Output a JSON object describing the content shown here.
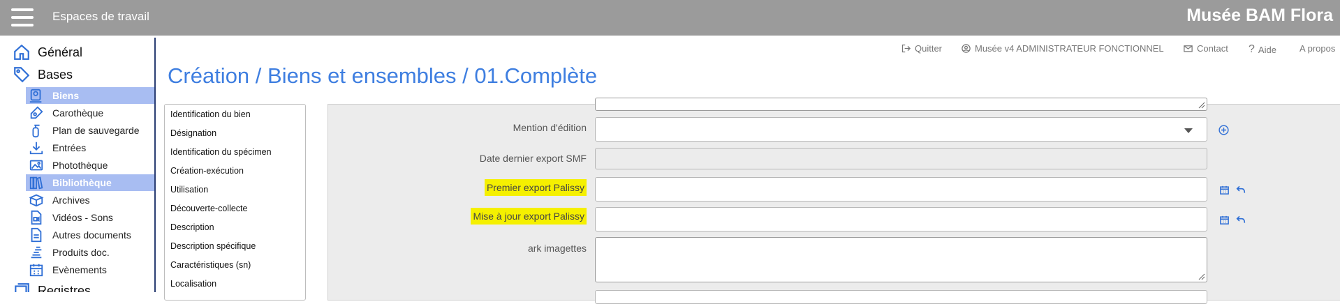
{
  "header": {
    "workspaces_label": "Espaces de travail",
    "app_title": "Musée BAM Flora"
  },
  "sidebar": {
    "general": "Général",
    "bases": "Bases",
    "registres": "Registres",
    "items": [
      {
        "label": "Biens"
      },
      {
        "label": "Carothèque"
      },
      {
        "label": "Plan de sauvegarde"
      },
      {
        "label": "Entrées"
      },
      {
        "label": "Photothèque"
      },
      {
        "label": "Bibliothèque"
      },
      {
        "label": "Archives"
      },
      {
        "label": "Vidéos - Sons"
      },
      {
        "label": "Autres documents"
      },
      {
        "label": "Produits doc."
      },
      {
        "label": "Evènements"
      }
    ]
  },
  "utility": {
    "quit": "Quitter",
    "user": "Musée v4 ADMINISTRATEUR FONCTIONNEL",
    "contact": "Contact",
    "help": "Aide",
    "about": "A propos"
  },
  "page": {
    "title": "Création / Biens et ensembles / 01.Complète"
  },
  "tabs": [
    "Identification du bien",
    "Désignation",
    "Identification du spécimen",
    "Création-exécution",
    "Utilisation",
    "Découverte-collecte",
    "Description",
    "Description spécifique",
    "Caractéristiques (sn)",
    "Localisation"
  ],
  "form": {
    "mention_edition": {
      "label": "Mention d'édition",
      "value": ""
    },
    "date_export_smf": {
      "label": "Date dernier export SMF",
      "value": ""
    },
    "premier_export": {
      "label": "Premier export Palissy",
      "value": ""
    },
    "maj_export": {
      "label": "Mise à jour export Palissy",
      "value": ""
    },
    "ark": {
      "label": "ark imagettes",
      "value": ""
    }
  },
  "colors": {
    "header_bg": "#9b9b9b",
    "accent": "#3e7ee0",
    "active_nav": "#a8bdf2",
    "highlight": "#f5f000"
  }
}
